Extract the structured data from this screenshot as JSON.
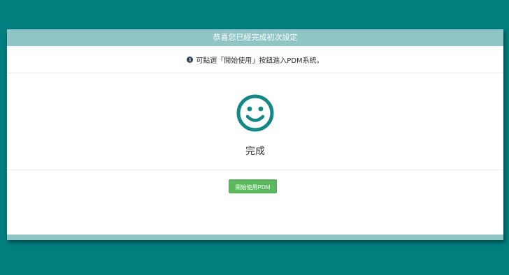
{
  "header": {
    "title": "恭喜您已經完成初次設定"
  },
  "info": {
    "icon": "info-circle-icon",
    "message": "可點選「開始使用」按鈕進入PDM系統。"
  },
  "status": {
    "icon": "smiley-icon",
    "label": "完成"
  },
  "actions": {
    "start_label": "開始使用PDM"
  },
  "colors": {
    "background": "#017f7e",
    "header": "#8fc5c4",
    "accent": "#138786",
    "button": "#5cb85c"
  }
}
